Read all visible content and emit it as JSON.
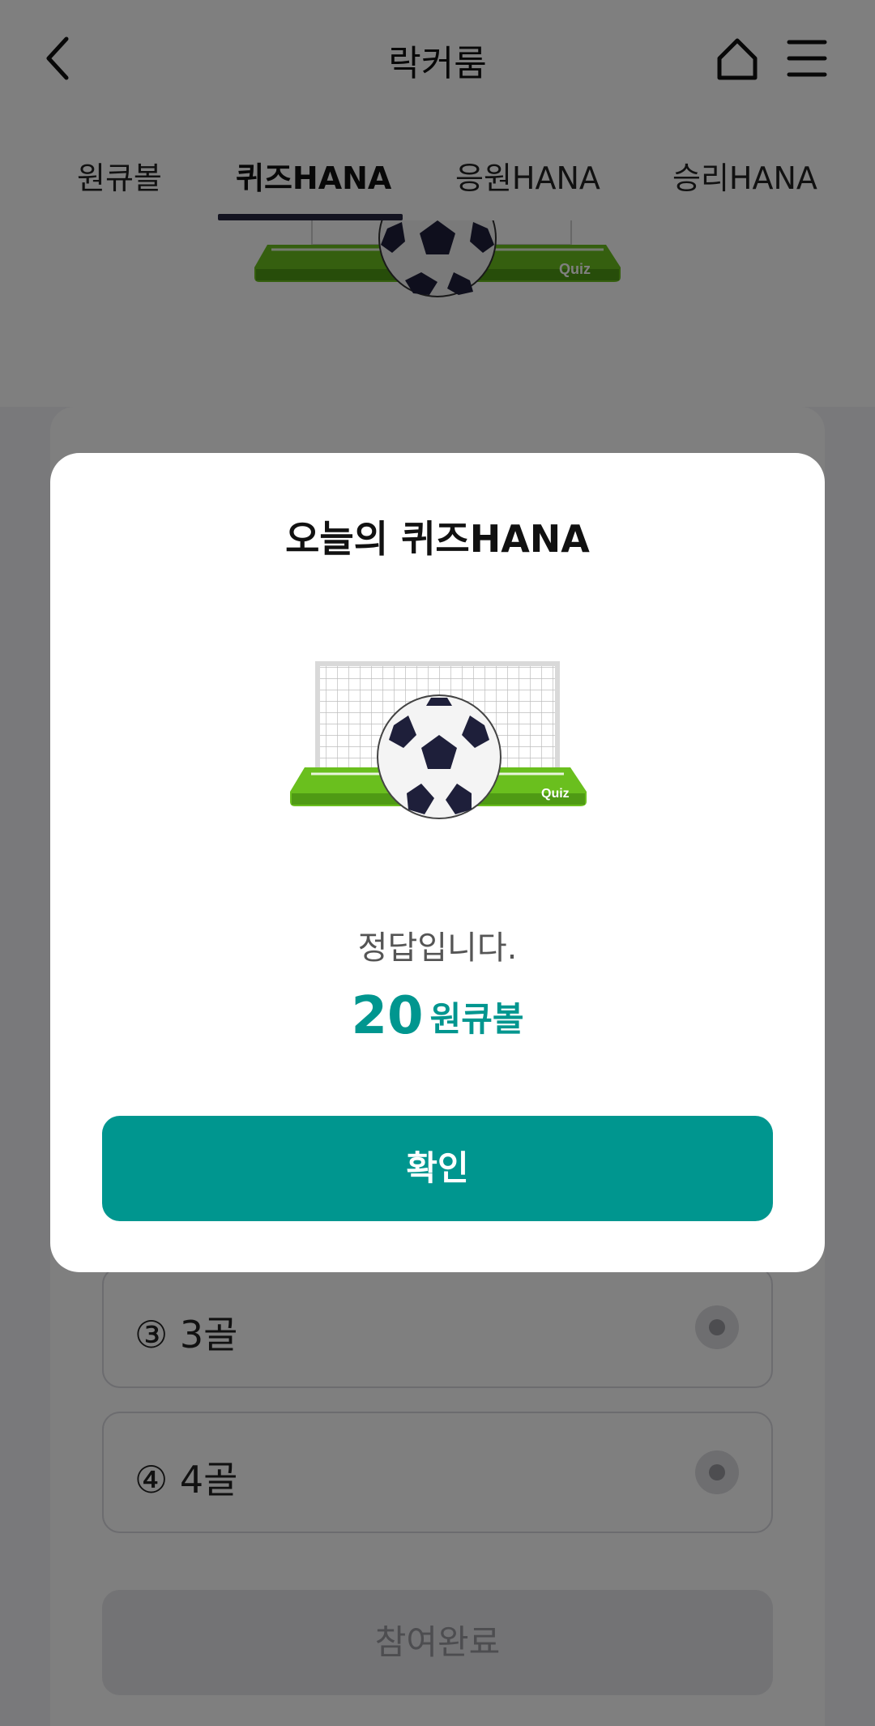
{
  "header": {
    "title": "락커룸"
  },
  "tabs": [
    {
      "label": "원큐볼",
      "active": false
    },
    {
      "label": "퀴즈HANA",
      "active": true
    },
    {
      "label": "응원HANA",
      "active": false
    },
    {
      "label": "승리HANA",
      "active": false
    }
  ],
  "background": {
    "goal_badge": "Quiz",
    "options": [
      {
        "label": "③ 3골"
      },
      {
        "label": "④ 4골"
      }
    ],
    "submit_label": "참여완료"
  },
  "modal": {
    "title": "오늘의 퀴즈HANA",
    "image_badge": "Quiz",
    "result_text": "정답입니다.",
    "reward_amount": "20",
    "reward_unit": "원큐볼",
    "confirm_label": "확인"
  },
  "colors": {
    "accent": "#00968f",
    "tab_indicator": "#262640",
    "dim_overlay": "rgba(0,0,0,0.5)",
    "pitch_green": "#6abf1e"
  },
  "icons": [
    "back-arrow-icon",
    "home-icon",
    "hamburger-menu-icon",
    "soccer-goal-illustration"
  ]
}
